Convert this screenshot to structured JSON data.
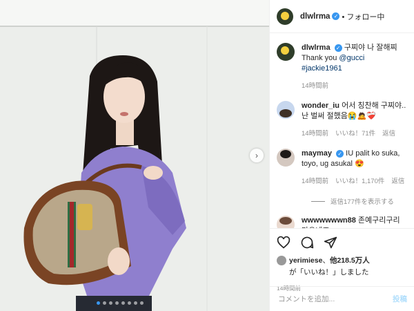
{
  "post": {
    "username": "dlwlrma",
    "follow_label": "• フォロー中"
  },
  "caption": {
    "username": "dlwlrma",
    "text": "구찌야 나 잘해찌",
    "line2_prefix": "Thank you ",
    "mention": "@gucci",
    "hashtag": "#jackie1961",
    "time": "14時間前"
  },
  "comments": [
    {
      "username": "wonder_iu",
      "text": "어서 칭찬해 구찌야.. 난 벌써 절했음😭🙇❤️‍🩹",
      "time": "14時間前",
      "likes": "いいね！71件",
      "reply": "返信"
    },
    {
      "username": "maymay",
      "text": "IU palit ko suka, toyo, ug asukal 😍",
      "time": "14時間前",
      "likes": "いいね！1,170件",
      "reply": "返信"
    },
    {
      "username": "wwwwwwwn88",
      "text": "존예구리구리 마요네즈"
    }
  ],
  "view_replies": "返信177件を表示する",
  "actions": {
    "icons": [
      "heart-icon",
      "comment-icon",
      "share-icon"
    ]
  },
  "likes": {
    "user": "yerimiese",
    "sep": "、",
    "others": "他218.5万人",
    "line2": "が「いいね！」しました"
  },
  "timestamp": "14時間前",
  "add_comment": {
    "placeholder": "コメントを追加...",
    "post": "投稿"
  },
  "colors": {
    "accent": "#3897f0",
    "sweater": "#8f7fce",
    "wall": "#e9ebe8"
  }
}
